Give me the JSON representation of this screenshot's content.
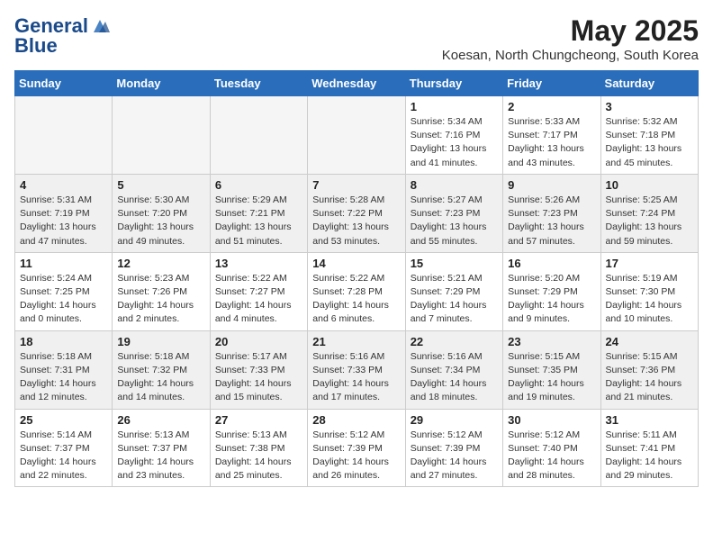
{
  "logo": {
    "line1": "General",
    "line2": "Blue"
  },
  "title": "May 2025",
  "subtitle": "Koesan, North Chungcheong, South Korea",
  "days_of_week": [
    "Sunday",
    "Monday",
    "Tuesday",
    "Wednesday",
    "Thursday",
    "Friday",
    "Saturday"
  ],
  "weeks": [
    [
      {
        "day": "",
        "info": ""
      },
      {
        "day": "",
        "info": ""
      },
      {
        "day": "",
        "info": ""
      },
      {
        "day": "",
        "info": ""
      },
      {
        "day": "1",
        "info": "Sunrise: 5:34 AM\nSunset: 7:16 PM\nDaylight: 13 hours\nand 41 minutes."
      },
      {
        "day": "2",
        "info": "Sunrise: 5:33 AM\nSunset: 7:17 PM\nDaylight: 13 hours\nand 43 minutes."
      },
      {
        "day": "3",
        "info": "Sunrise: 5:32 AM\nSunset: 7:18 PM\nDaylight: 13 hours\nand 45 minutes."
      }
    ],
    [
      {
        "day": "4",
        "info": "Sunrise: 5:31 AM\nSunset: 7:19 PM\nDaylight: 13 hours\nand 47 minutes."
      },
      {
        "day": "5",
        "info": "Sunrise: 5:30 AM\nSunset: 7:20 PM\nDaylight: 13 hours\nand 49 minutes."
      },
      {
        "day": "6",
        "info": "Sunrise: 5:29 AM\nSunset: 7:21 PM\nDaylight: 13 hours\nand 51 minutes."
      },
      {
        "day": "7",
        "info": "Sunrise: 5:28 AM\nSunset: 7:22 PM\nDaylight: 13 hours\nand 53 minutes."
      },
      {
        "day": "8",
        "info": "Sunrise: 5:27 AM\nSunset: 7:23 PM\nDaylight: 13 hours\nand 55 minutes."
      },
      {
        "day": "9",
        "info": "Sunrise: 5:26 AM\nSunset: 7:23 PM\nDaylight: 13 hours\nand 57 minutes."
      },
      {
        "day": "10",
        "info": "Sunrise: 5:25 AM\nSunset: 7:24 PM\nDaylight: 13 hours\nand 59 minutes."
      }
    ],
    [
      {
        "day": "11",
        "info": "Sunrise: 5:24 AM\nSunset: 7:25 PM\nDaylight: 14 hours\nand 0 minutes."
      },
      {
        "day": "12",
        "info": "Sunrise: 5:23 AM\nSunset: 7:26 PM\nDaylight: 14 hours\nand 2 minutes."
      },
      {
        "day": "13",
        "info": "Sunrise: 5:22 AM\nSunset: 7:27 PM\nDaylight: 14 hours\nand 4 minutes."
      },
      {
        "day": "14",
        "info": "Sunrise: 5:22 AM\nSunset: 7:28 PM\nDaylight: 14 hours\nand 6 minutes."
      },
      {
        "day": "15",
        "info": "Sunrise: 5:21 AM\nSunset: 7:29 PM\nDaylight: 14 hours\nand 7 minutes."
      },
      {
        "day": "16",
        "info": "Sunrise: 5:20 AM\nSunset: 7:29 PM\nDaylight: 14 hours\nand 9 minutes."
      },
      {
        "day": "17",
        "info": "Sunrise: 5:19 AM\nSunset: 7:30 PM\nDaylight: 14 hours\nand 10 minutes."
      }
    ],
    [
      {
        "day": "18",
        "info": "Sunrise: 5:18 AM\nSunset: 7:31 PM\nDaylight: 14 hours\nand 12 minutes."
      },
      {
        "day": "19",
        "info": "Sunrise: 5:18 AM\nSunset: 7:32 PM\nDaylight: 14 hours\nand 14 minutes."
      },
      {
        "day": "20",
        "info": "Sunrise: 5:17 AM\nSunset: 7:33 PM\nDaylight: 14 hours\nand 15 minutes."
      },
      {
        "day": "21",
        "info": "Sunrise: 5:16 AM\nSunset: 7:33 PM\nDaylight: 14 hours\nand 17 minutes."
      },
      {
        "day": "22",
        "info": "Sunrise: 5:16 AM\nSunset: 7:34 PM\nDaylight: 14 hours\nand 18 minutes."
      },
      {
        "day": "23",
        "info": "Sunrise: 5:15 AM\nSunset: 7:35 PM\nDaylight: 14 hours\nand 19 minutes."
      },
      {
        "day": "24",
        "info": "Sunrise: 5:15 AM\nSunset: 7:36 PM\nDaylight: 14 hours\nand 21 minutes."
      }
    ],
    [
      {
        "day": "25",
        "info": "Sunrise: 5:14 AM\nSunset: 7:37 PM\nDaylight: 14 hours\nand 22 minutes."
      },
      {
        "day": "26",
        "info": "Sunrise: 5:13 AM\nSunset: 7:37 PM\nDaylight: 14 hours\nand 23 minutes."
      },
      {
        "day": "27",
        "info": "Sunrise: 5:13 AM\nSunset: 7:38 PM\nDaylight: 14 hours\nand 25 minutes."
      },
      {
        "day": "28",
        "info": "Sunrise: 5:12 AM\nSunset: 7:39 PM\nDaylight: 14 hours\nand 26 minutes."
      },
      {
        "day": "29",
        "info": "Sunrise: 5:12 AM\nSunset: 7:39 PM\nDaylight: 14 hours\nand 27 minutes."
      },
      {
        "day": "30",
        "info": "Sunrise: 5:12 AM\nSunset: 7:40 PM\nDaylight: 14 hours\nand 28 minutes."
      },
      {
        "day": "31",
        "info": "Sunrise: 5:11 AM\nSunset: 7:41 PM\nDaylight: 14 hours\nand 29 minutes."
      }
    ]
  ]
}
